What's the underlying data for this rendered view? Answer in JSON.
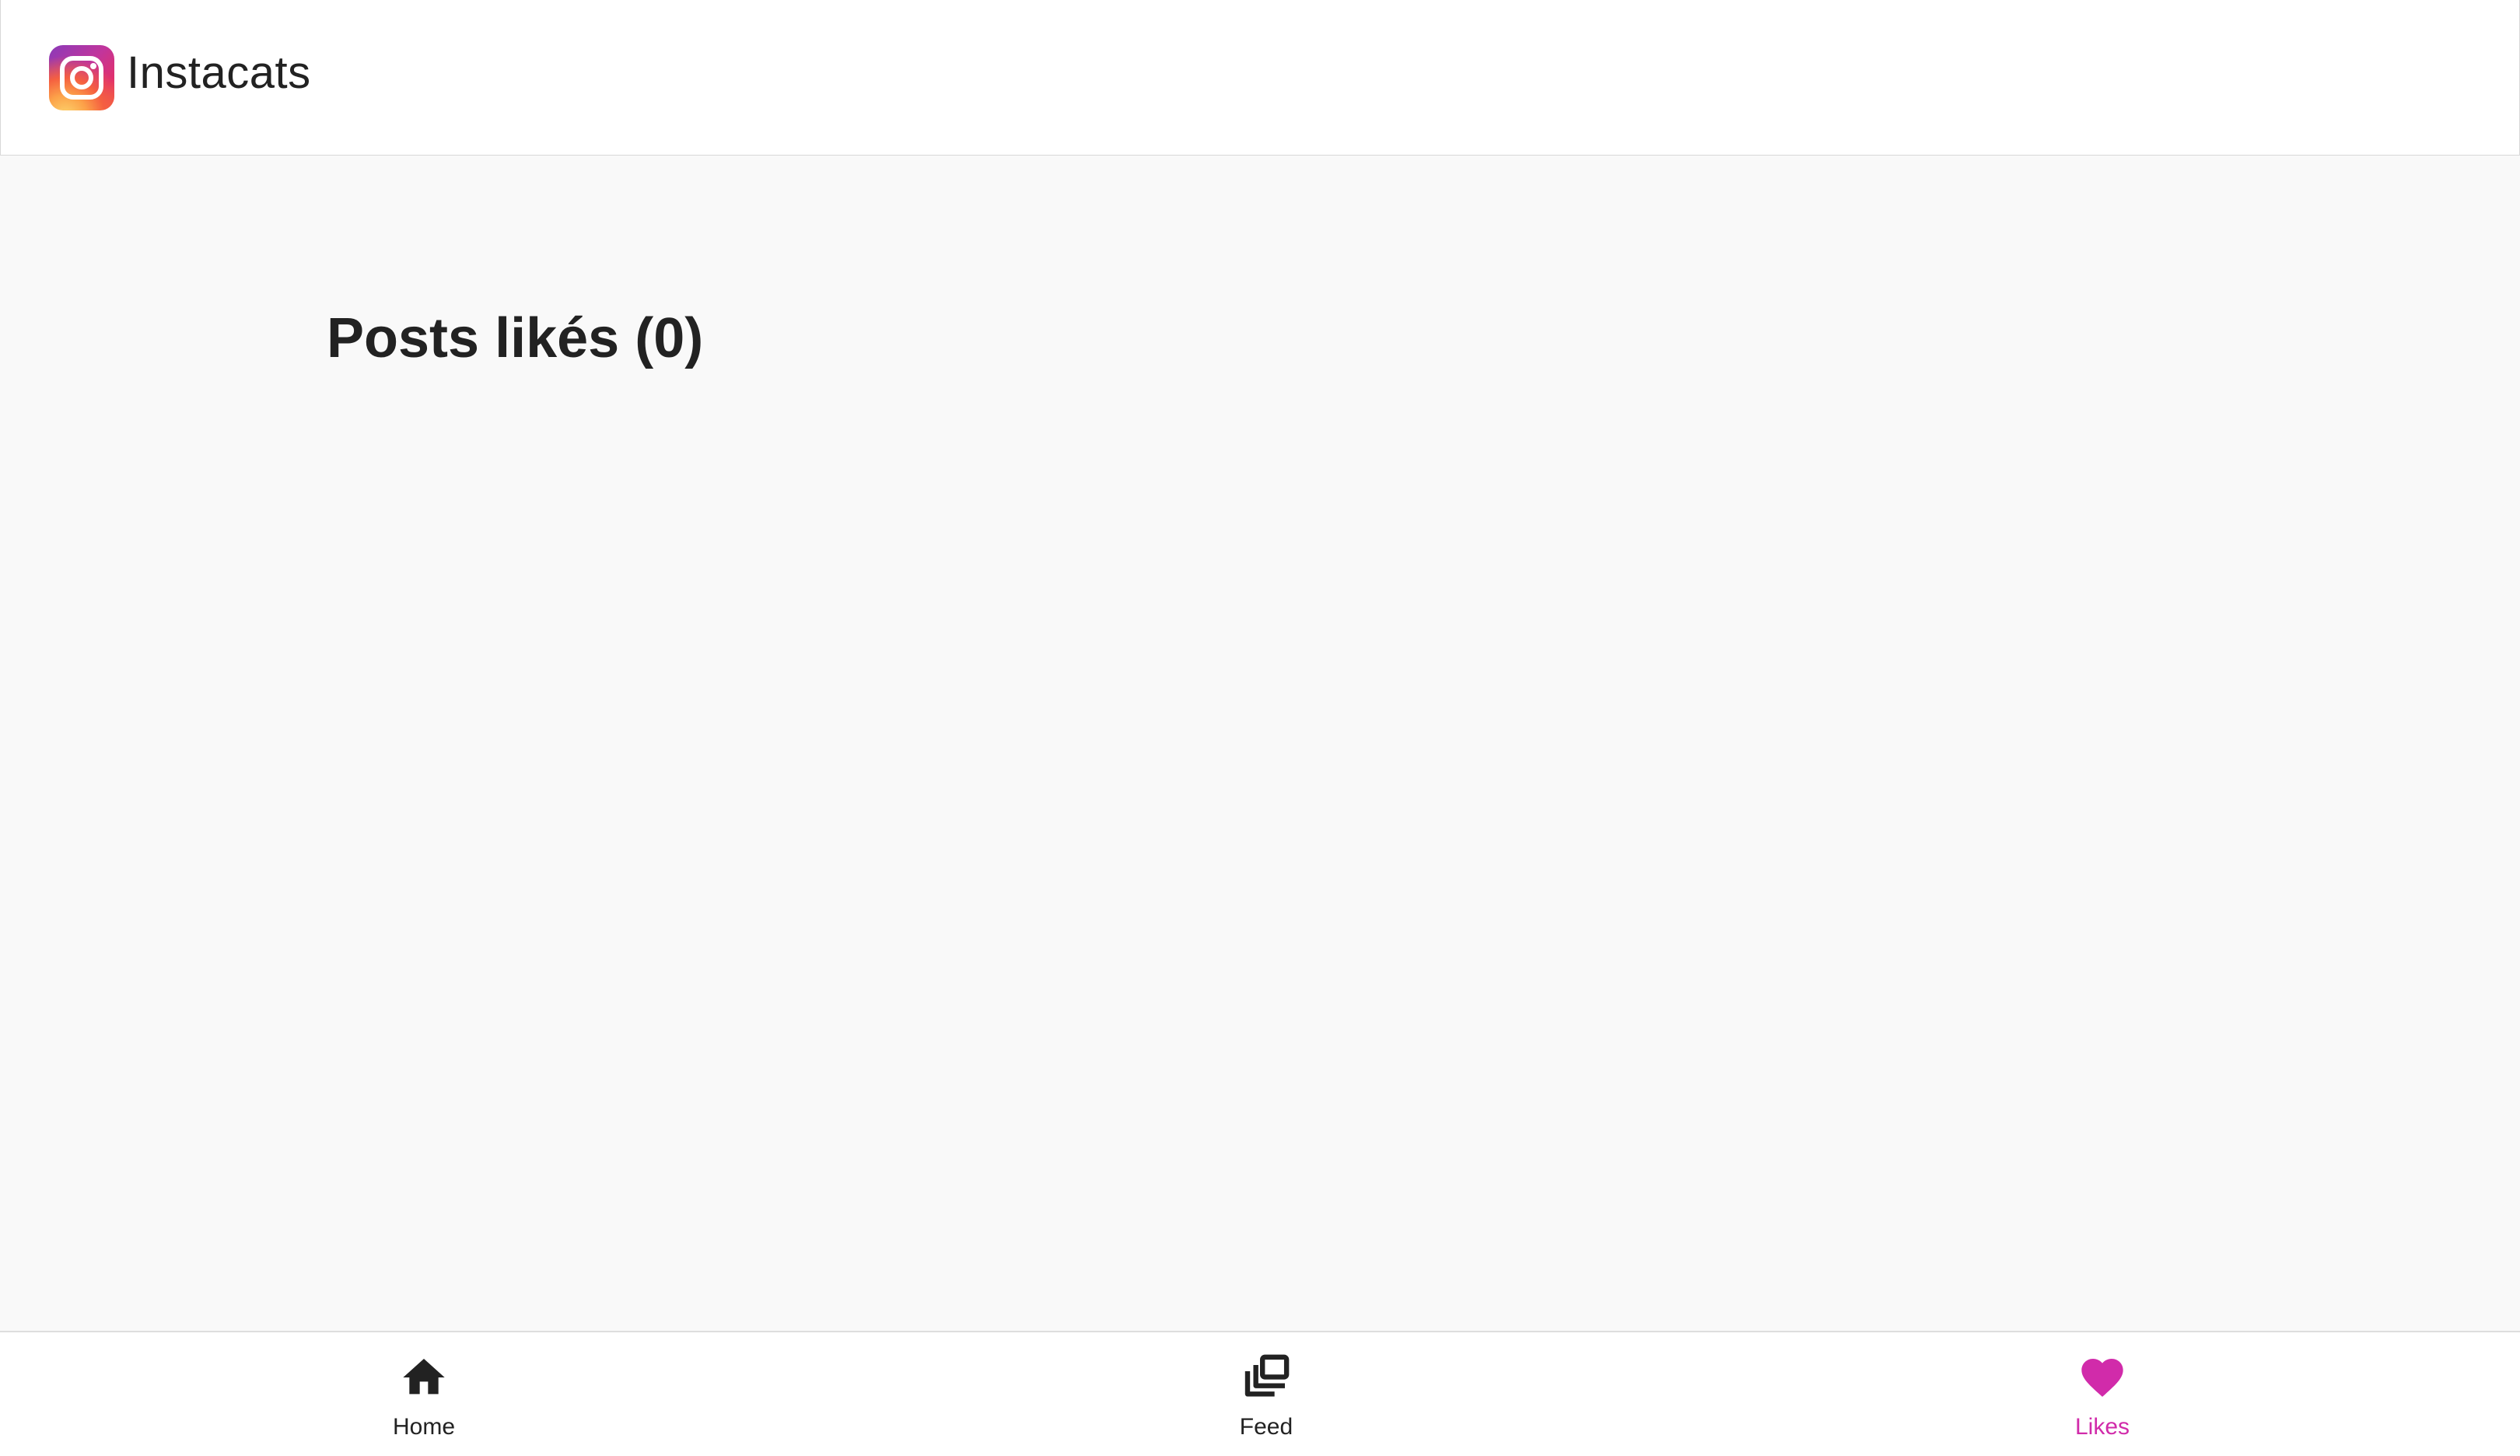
{
  "header": {
    "app_name": "Instacats",
    "logo_icon": "instagram-logo-icon"
  },
  "main": {
    "title": "Posts likés (0)"
  },
  "bottom_nav": {
    "items": [
      {
        "label": "Home",
        "icon": "home-icon",
        "active": false
      },
      {
        "label": "Feed",
        "icon": "stacked-images-icon",
        "active": false
      },
      {
        "label": "Likes",
        "icon": "heart-icon",
        "active": true
      }
    ]
  },
  "colors": {
    "accent": "#d12baa",
    "text": "#222222",
    "background": "#f9f9f9",
    "surface": "#ffffff"
  }
}
